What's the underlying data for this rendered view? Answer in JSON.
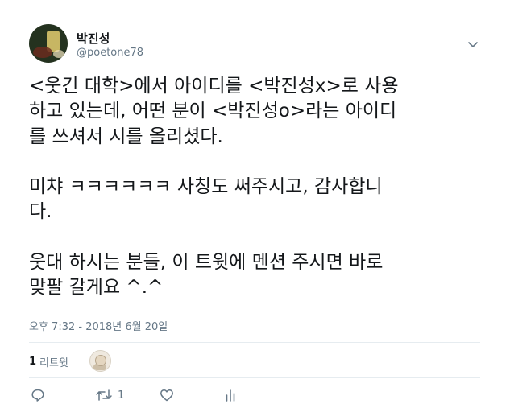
{
  "user": {
    "display_name": "박진성",
    "handle": "@poetone78"
  },
  "tweet": {
    "text": "<웃긴 대학>에서 아이디를 <박진성x>로 사용\n하고 있는데, 어떤 분이 <박진성o>라는 아이디\n를 쓰셔서 시를 올리셨다.\n\n미챠 ㅋㅋㅋㅋㅋㅋ 사칭도 써주시고, 감사합니\n다.\n\n웃대 하시는 분들, 이 트윗에 멘션 주시면 바로\n맞팔 갈게요 ^.^",
    "timestamp": "오후 7:32 - 2018년 6월 20일"
  },
  "stats": {
    "retweet_count": "1",
    "retweet_label": "리트윗"
  },
  "actions": {
    "reply_icon": "reply-icon",
    "retweet_icon": "retweet-icon",
    "retweet_count": "1",
    "like_icon": "heart-icon",
    "analytics_icon": "analytics-icon"
  },
  "colors": {
    "text": "#14171a",
    "muted": "#657786",
    "divider": "#e6ecf0"
  }
}
